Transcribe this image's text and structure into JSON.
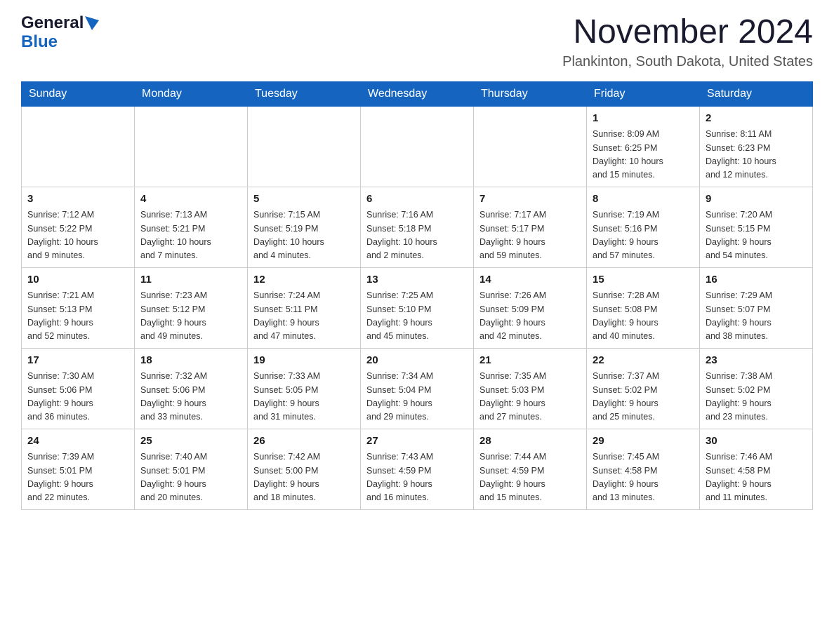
{
  "header": {
    "logo_general": "General",
    "logo_blue": "Blue",
    "month_title": "November 2024",
    "location": "Plankinton, South Dakota, United States"
  },
  "days_of_week": [
    "Sunday",
    "Monday",
    "Tuesday",
    "Wednesday",
    "Thursday",
    "Friday",
    "Saturday"
  ],
  "weeks": [
    [
      {
        "day": "",
        "info": ""
      },
      {
        "day": "",
        "info": ""
      },
      {
        "day": "",
        "info": ""
      },
      {
        "day": "",
        "info": ""
      },
      {
        "day": "",
        "info": ""
      },
      {
        "day": "1",
        "info": "Sunrise: 8:09 AM\nSunset: 6:25 PM\nDaylight: 10 hours\nand 15 minutes."
      },
      {
        "day": "2",
        "info": "Sunrise: 8:11 AM\nSunset: 6:23 PM\nDaylight: 10 hours\nand 12 minutes."
      }
    ],
    [
      {
        "day": "3",
        "info": "Sunrise: 7:12 AM\nSunset: 5:22 PM\nDaylight: 10 hours\nand 9 minutes."
      },
      {
        "day": "4",
        "info": "Sunrise: 7:13 AM\nSunset: 5:21 PM\nDaylight: 10 hours\nand 7 minutes."
      },
      {
        "day": "5",
        "info": "Sunrise: 7:15 AM\nSunset: 5:19 PM\nDaylight: 10 hours\nand 4 minutes."
      },
      {
        "day": "6",
        "info": "Sunrise: 7:16 AM\nSunset: 5:18 PM\nDaylight: 10 hours\nand 2 minutes."
      },
      {
        "day": "7",
        "info": "Sunrise: 7:17 AM\nSunset: 5:17 PM\nDaylight: 9 hours\nand 59 minutes."
      },
      {
        "day": "8",
        "info": "Sunrise: 7:19 AM\nSunset: 5:16 PM\nDaylight: 9 hours\nand 57 minutes."
      },
      {
        "day": "9",
        "info": "Sunrise: 7:20 AM\nSunset: 5:15 PM\nDaylight: 9 hours\nand 54 minutes."
      }
    ],
    [
      {
        "day": "10",
        "info": "Sunrise: 7:21 AM\nSunset: 5:13 PM\nDaylight: 9 hours\nand 52 minutes."
      },
      {
        "day": "11",
        "info": "Sunrise: 7:23 AM\nSunset: 5:12 PM\nDaylight: 9 hours\nand 49 minutes."
      },
      {
        "day": "12",
        "info": "Sunrise: 7:24 AM\nSunset: 5:11 PM\nDaylight: 9 hours\nand 47 minutes."
      },
      {
        "day": "13",
        "info": "Sunrise: 7:25 AM\nSunset: 5:10 PM\nDaylight: 9 hours\nand 45 minutes."
      },
      {
        "day": "14",
        "info": "Sunrise: 7:26 AM\nSunset: 5:09 PM\nDaylight: 9 hours\nand 42 minutes."
      },
      {
        "day": "15",
        "info": "Sunrise: 7:28 AM\nSunset: 5:08 PM\nDaylight: 9 hours\nand 40 minutes."
      },
      {
        "day": "16",
        "info": "Sunrise: 7:29 AM\nSunset: 5:07 PM\nDaylight: 9 hours\nand 38 minutes."
      }
    ],
    [
      {
        "day": "17",
        "info": "Sunrise: 7:30 AM\nSunset: 5:06 PM\nDaylight: 9 hours\nand 36 minutes."
      },
      {
        "day": "18",
        "info": "Sunrise: 7:32 AM\nSunset: 5:06 PM\nDaylight: 9 hours\nand 33 minutes."
      },
      {
        "day": "19",
        "info": "Sunrise: 7:33 AM\nSunset: 5:05 PM\nDaylight: 9 hours\nand 31 minutes."
      },
      {
        "day": "20",
        "info": "Sunrise: 7:34 AM\nSunset: 5:04 PM\nDaylight: 9 hours\nand 29 minutes."
      },
      {
        "day": "21",
        "info": "Sunrise: 7:35 AM\nSunset: 5:03 PM\nDaylight: 9 hours\nand 27 minutes."
      },
      {
        "day": "22",
        "info": "Sunrise: 7:37 AM\nSunset: 5:02 PM\nDaylight: 9 hours\nand 25 minutes."
      },
      {
        "day": "23",
        "info": "Sunrise: 7:38 AM\nSunset: 5:02 PM\nDaylight: 9 hours\nand 23 minutes."
      }
    ],
    [
      {
        "day": "24",
        "info": "Sunrise: 7:39 AM\nSunset: 5:01 PM\nDaylight: 9 hours\nand 22 minutes."
      },
      {
        "day": "25",
        "info": "Sunrise: 7:40 AM\nSunset: 5:01 PM\nDaylight: 9 hours\nand 20 minutes."
      },
      {
        "day": "26",
        "info": "Sunrise: 7:42 AM\nSunset: 5:00 PM\nDaylight: 9 hours\nand 18 minutes."
      },
      {
        "day": "27",
        "info": "Sunrise: 7:43 AM\nSunset: 4:59 PM\nDaylight: 9 hours\nand 16 minutes."
      },
      {
        "day": "28",
        "info": "Sunrise: 7:44 AM\nSunset: 4:59 PM\nDaylight: 9 hours\nand 15 minutes."
      },
      {
        "day": "29",
        "info": "Sunrise: 7:45 AM\nSunset: 4:58 PM\nDaylight: 9 hours\nand 13 minutes."
      },
      {
        "day": "30",
        "info": "Sunrise: 7:46 AM\nSunset: 4:58 PM\nDaylight: 9 hours\nand 11 minutes."
      }
    ]
  ]
}
